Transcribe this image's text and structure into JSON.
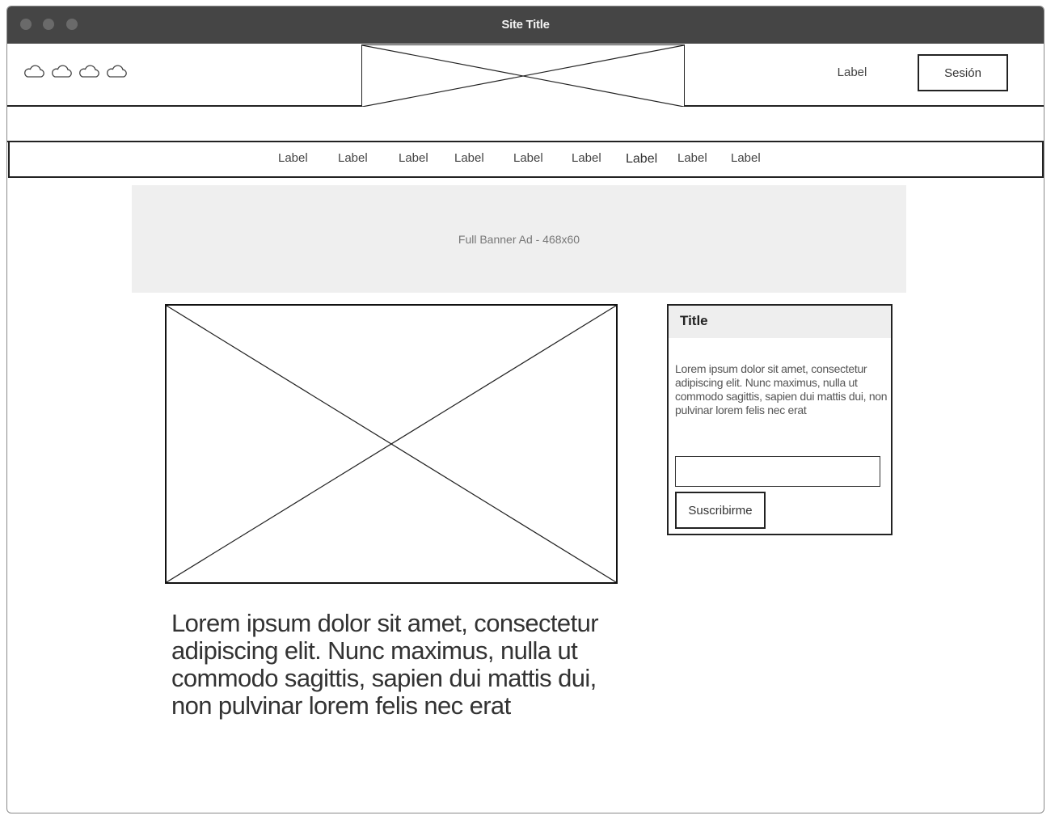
{
  "window": {
    "title": "Site Title"
  },
  "header": {
    "icons": [
      "cloud-icon",
      "cloud-icon",
      "cloud-icon",
      "cloud-icon"
    ],
    "label": "Label",
    "session_button": "Sesión"
  },
  "nav": {
    "items": [
      "Label",
      "Label",
      "Label",
      "Label",
      "Label",
      "Label",
      "Label",
      "Label",
      "Label"
    ]
  },
  "banner": {
    "text": "Full Banner Ad - 468x60"
  },
  "main": {
    "text": "Lorem ipsum dolor sit amet, consectetur adipiscing elit. Nunc maximus, nulla ut commodo sagittis, sapien dui mattis dui, non pulvinar lorem felis nec erat"
  },
  "widget": {
    "title": "Title",
    "text": "Lorem ipsum dolor sit amet, consectetur adipiscing elit. Nunc maximus, nulla ut commodo sagittis, sapien dui mattis dui, non pulvinar lorem felis nec erat",
    "input_value": "",
    "button": "Suscribirme"
  }
}
